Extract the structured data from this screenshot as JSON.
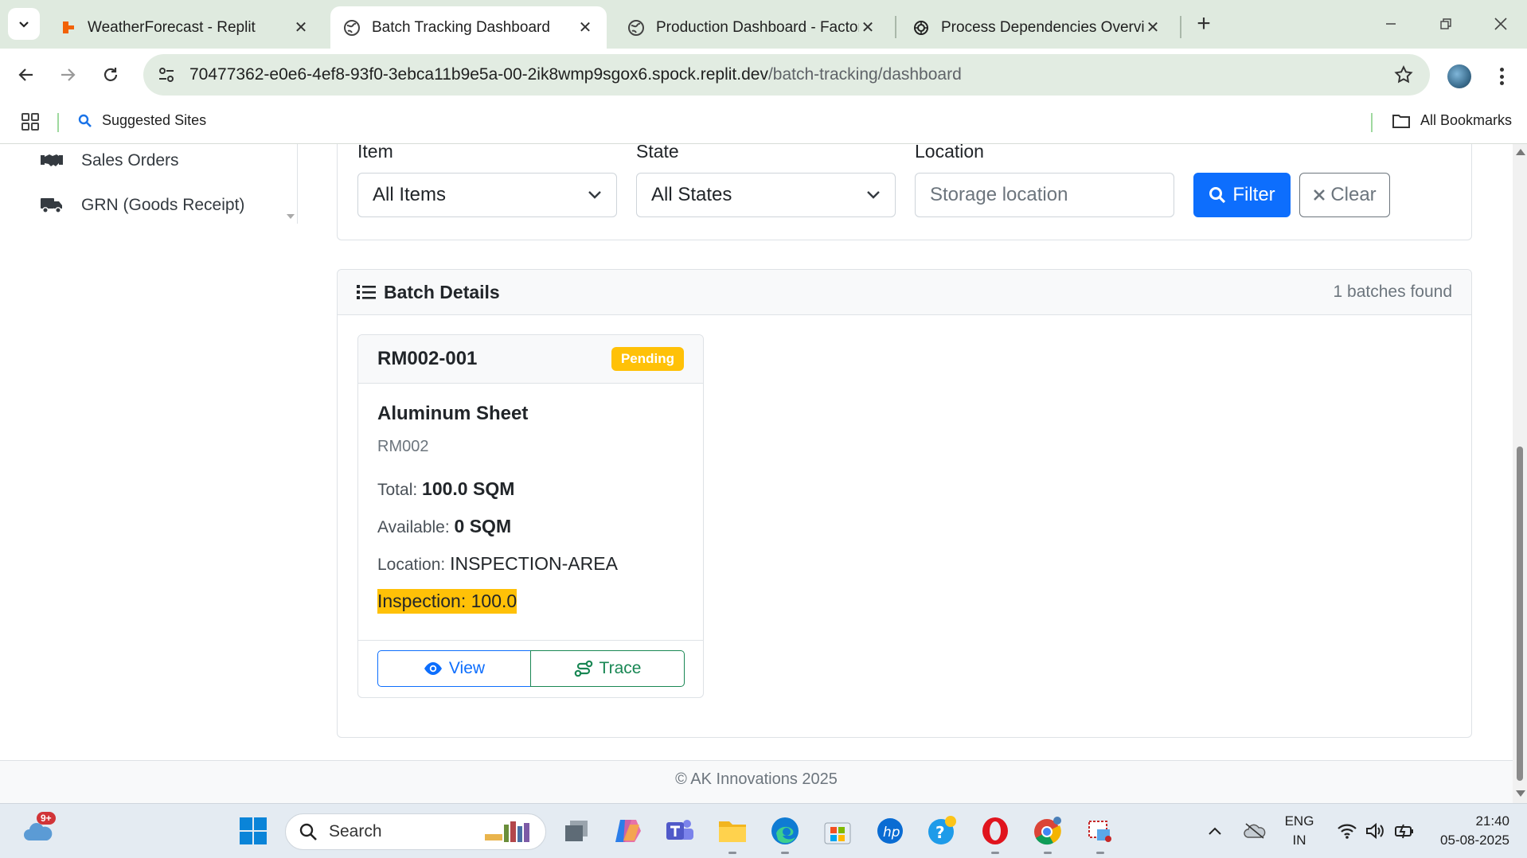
{
  "browser": {
    "tabs": [
      {
        "title": "WeatherForecast - Replit",
        "icon": "replit-icon",
        "active": false
      },
      {
        "title": "Batch Tracking Dashboard",
        "icon": "globe-icon",
        "active": true
      },
      {
        "title": "Production Dashboard - Factory",
        "icon": "globe-icon",
        "active": false
      },
      {
        "title": "Process Dependencies Overview",
        "icon": "openai-icon",
        "active": false
      }
    ],
    "url_host": "70477362-e0e6-4ef8-93f0-3ebca11b9e5a-00-2ik8wmp9sgox6.spock.replit.dev",
    "url_path": "/batch-tracking/dashboard",
    "bookmarks": {
      "suggested": "Suggested Sites",
      "all": "All Bookmarks"
    }
  },
  "sidebar": {
    "items": [
      {
        "label": "Sales Orders",
        "icon": "handshake-icon"
      },
      {
        "label": "GRN (Goods Receipt)",
        "icon": "truck-icon"
      }
    ]
  },
  "filters": {
    "item_label": "Item",
    "item_value": "All Items",
    "state_label": "State",
    "state_value": "All States",
    "location_label": "Location",
    "location_placeholder": "Storage location",
    "filter_button": "Filter",
    "clear_button": "Clear"
  },
  "details": {
    "title": "Batch Details",
    "count_text": "1 batches found",
    "batches": [
      {
        "code": "RM002-001",
        "status": "Pending",
        "name": "Aluminum Sheet",
        "item_code": "RM002",
        "total_label": "Total:",
        "total_value": "100.0 SQM",
        "available_label": "Available:",
        "available_value": "0 SQM",
        "location_label": "Location:",
        "location_value": "INSPECTION-AREA",
        "inspection_text": "Inspection: 100.0",
        "view_label": "View",
        "trace_label": "Trace"
      }
    ]
  },
  "footer": {
    "text": "© AK Innovations 2025"
  },
  "taskbar": {
    "weather_badge": "9+",
    "search_placeholder": "Search",
    "lang_top": "ENG",
    "lang_bottom": "IN",
    "time": "21:40",
    "date": "05-08-2025"
  },
  "colors": {
    "primary": "#0d6efd",
    "success": "#198754",
    "warning": "#ffc107",
    "chrome_bg": "#dfeadf"
  }
}
